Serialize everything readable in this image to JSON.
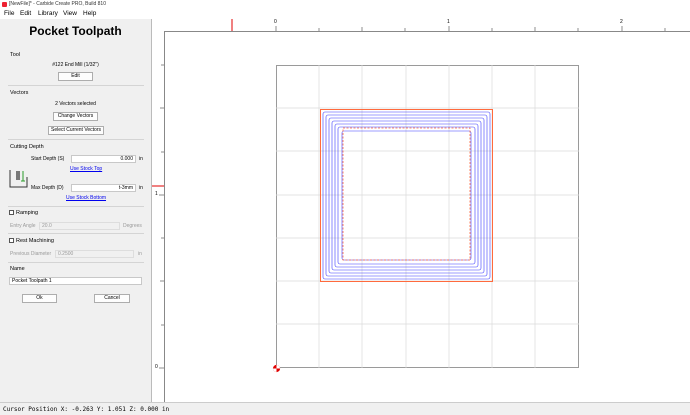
{
  "window": {
    "title": "[NewFile]* - Carbide Create PRO, Build 810"
  },
  "menu": [
    "File",
    "Edit",
    "Library",
    "View",
    "Help"
  ],
  "panel": {
    "title": "Pocket Toolpath",
    "tool": {
      "heading": "Tool",
      "name": "#122 End Mill (1/32\")",
      "edit_label": "Edit"
    },
    "vectors": {
      "heading": "Vectors",
      "selected": "2 Vectors selected",
      "change_label": "Change Vectors",
      "select_label": "Select Current Vectors"
    },
    "depth": {
      "heading": "Cutting Depth",
      "start_label": "Start Depth (S)",
      "start_value": "0.000",
      "start_unit": "in",
      "use_stock_top": "Use Stock Top",
      "max_label": "Max Depth (D)",
      "max_value": "t-3mm",
      "max_unit": "in",
      "use_stock_bottom": "Use Stock Bottom"
    },
    "ramping": {
      "label": "Ramping",
      "checked": false,
      "angle_label": "Entry Angle",
      "angle_value": "20.0",
      "angle_unit": "Degrees"
    },
    "rest": {
      "label": "Rest Machining",
      "checked": false,
      "diam_label": "Previous Diameter",
      "diam_value": "0.2500",
      "diam_unit": "in"
    },
    "name": {
      "heading": "Name",
      "value": "Pocket Toolpath 1"
    },
    "ok_label": "Ok",
    "cancel_label": "Cancel"
  },
  "rulers": {
    "h": [
      "0",
      "1",
      "2"
    ],
    "v": [
      "1",
      "0"
    ]
  },
  "status": {
    "text": "Cursor Position X: -0.263 Y: 1.051 Z: 0.000 in"
  },
  "colors": {
    "vector": "#ff6a3d",
    "toolpath": "#3a3aff",
    "grid": "#d8d8d8",
    "marker": "#e00000"
  }
}
